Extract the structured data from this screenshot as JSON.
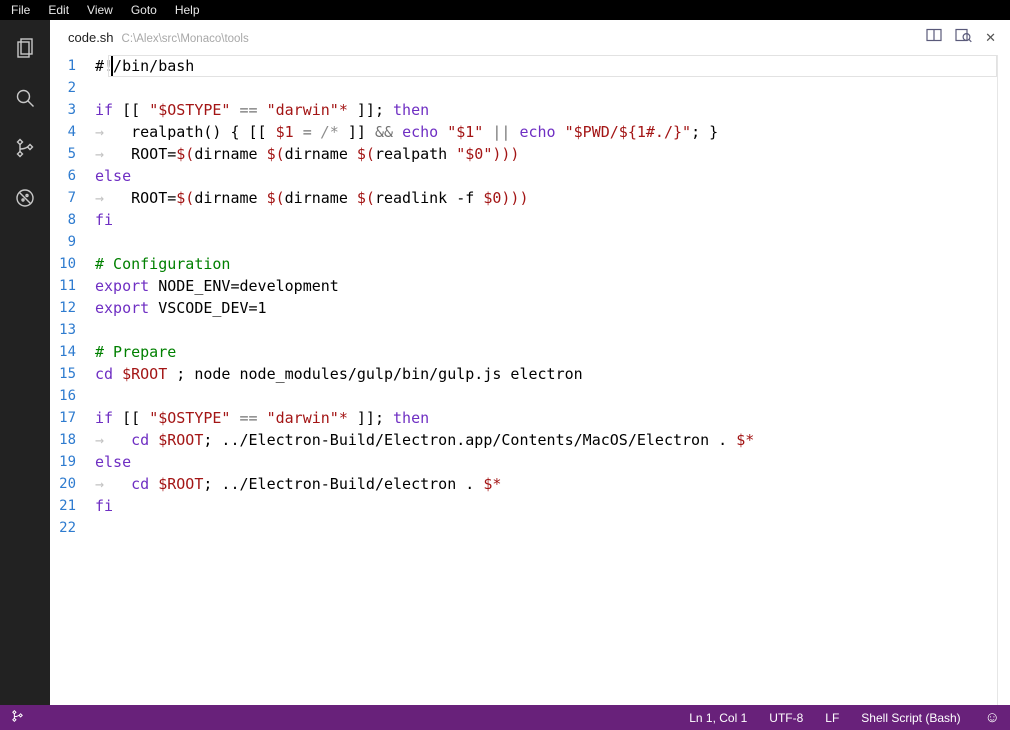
{
  "menu_bar": {
    "items": [
      "File",
      "Edit",
      "View",
      "Goto",
      "Help"
    ]
  },
  "activity_bar": {
    "icons": [
      "files",
      "search",
      "git",
      "no-debug"
    ]
  },
  "tab_bar": {
    "file_name": "code.sh",
    "file_path": "C:\\Alex\\src\\Monaco\\tools",
    "actions": {
      "split_editor": "split-editor",
      "preview": "open-preview",
      "close": "✕"
    }
  },
  "editor": {
    "cursor": {
      "line": 1,
      "col": 1
    },
    "lines": [
      [
        [
          "#!/bin/bash",
          "d"
        ]
      ],
      [],
      [
        [
          "if",
          "k"
        ],
        [
          " [[ ",
          "d"
        ],
        [
          "\"$OSTYPE\"",
          "s"
        ],
        [
          " ",
          "d"
        ],
        [
          "==",
          "o"
        ],
        [
          " ",
          "d"
        ],
        [
          "\"darwin\"*",
          "s"
        ],
        [
          " ]]; ",
          "d"
        ],
        [
          "then",
          "k"
        ]
      ],
      [
        [
          "→   ",
          "w"
        ],
        [
          "realpath() { [[ ",
          "d"
        ],
        [
          "$1",
          "v"
        ],
        [
          " ",
          "d"
        ],
        [
          "=",
          "o"
        ],
        [
          " ",
          "d"
        ],
        [
          "/*",
          "g"
        ],
        [
          " ]] ",
          "d"
        ],
        [
          "&&",
          "o"
        ],
        [
          " ",
          "d"
        ],
        [
          "echo",
          "k"
        ],
        [
          " ",
          "d"
        ],
        [
          "\"$1\"",
          "s"
        ],
        [
          " ",
          "d"
        ],
        [
          "||",
          "o"
        ],
        [
          " ",
          "d"
        ],
        [
          "echo",
          "k"
        ],
        [
          " ",
          "d"
        ],
        [
          "\"$PWD/${1#./}\"",
          "s"
        ],
        [
          "; }",
          "d"
        ]
      ],
      [
        [
          "→   ",
          "w"
        ],
        [
          "ROOT=",
          "d"
        ],
        [
          "$(",
          "v"
        ],
        [
          "dirname ",
          "d"
        ],
        [
          "$(",
          "v"
        ],
        [
          "dirname ",
          "d"
        ],
        [
          "$(",
          "v"
        ],
        [
          "realpath ",
          "d"
        ],
        [
          "\"$0\"",
          "s"
        ],
        [
          ")))",
          "v"
        ]
      ],
      [
        [
          "else",
          "k"
        ]
      ],
      [
        [
          "→   ",
          "w"
        ],
        [
          "ROOT=",
          "d"
        ],
        [
          "$(",
          "v"
        ],
        [
          "dirname ",
          "d"
        ],
        [
          "$(",
          "v"
        ],
        [
          "dirname ",
          "d"
        ],
        [
          "$(",
          "v"
        ],
        [
          "readlink -f ",
          "d"
        ],
        [
          "$0",
          "v"
        ],
        [
          ")))",
          "v"
        ]
      ],
      [
        [
          "fi",
          "k"
        ]
      ],
      [],
      [
        [
          "# Configuration",
          "c"
        ]
      ],
      [
        [
          "export",
          "k"
        ],
        [
          " NODE_ENV=development",
          "d"
        ]
      ],
      [
        [
          "export",
          "k"
        ],
        [
          " VSCODE_DEV=1",
          "d"
        ]
      ],
      [],
      [
        [
          "# Prepare",
          "c"
        ]
      ],
      [
        [
          "cd",
          "k"
        ],
        [
          " ",
          "d"
        ],
        [
          "$ROOT",
          "v"
        ],
        [
          " ; node node_modules/gulp/bin/gulp.js electron",
          "d"
        ]
      ],
      [],
      [
        [
          "if",
          "k"
        ],
        [
          " [[ ",
          "d"
        ],
        [
          "\"$OSTYPE\"",
          "s"
        ],
        [
          " ",
          "d"
        ],
        [
          "==",
          "o"
        ],
        [
          " ",
          "d"
        ],
        [
          "\"darwin\"*",
          "s"
        ],
        [
          " ]]; ",
          "d"
        ],
        [
          "then",
          "k"
        ]
      ],
      [
        [
          "→   ",
          "w"
        ],
        [
          "cd",
          "k"
        ],
        [
          " ",
          "d"
        ],
        [
          "$ROOT",
          "v"
        ],
        [
          "; ../Electron-Build/Electron.app/Contents/MacOS/Electron . ",
          "d"
        ],
        [
          "$*",
          "v"
        ]
      ],
      [
        [
          "else",
          "k"
        ]
      ],
      [
        [
          "→   ",
          "w"
        ],
        [
          "cd",
          "k"
        ],
        [
          " ",
          "d"
        ],
        [
          "$ROOT",
          "v"
        ],
        [
          "; ../Electron-Build/electron . ",
          "d"
        ],
        [
          "$*",
          "v"
        ]
      ],
      [
        [
          "fi",
          "k"
        ]
      ],
      []
    ]
  },
  "status_bar": {
    "left_icon": "git-branch",
    "right": [
      "Ln 1, Col 1",
      "UTF-8",
      "LF",
      "Shell Script (Bash)"
    ],
    "smiley": "☺"
  },
  "colors": {
    "status_bar_bg": "#68217A",
    "keyword": "#6f2fc3",
    "string": "#a31515",
    "variable": "#a31515",
    "comment": "#008000",
    "operator": "#737373",
    "line_number": "#2e7bcf",
    "whitespace_glyph": "#c3c3c3"
  }
}
